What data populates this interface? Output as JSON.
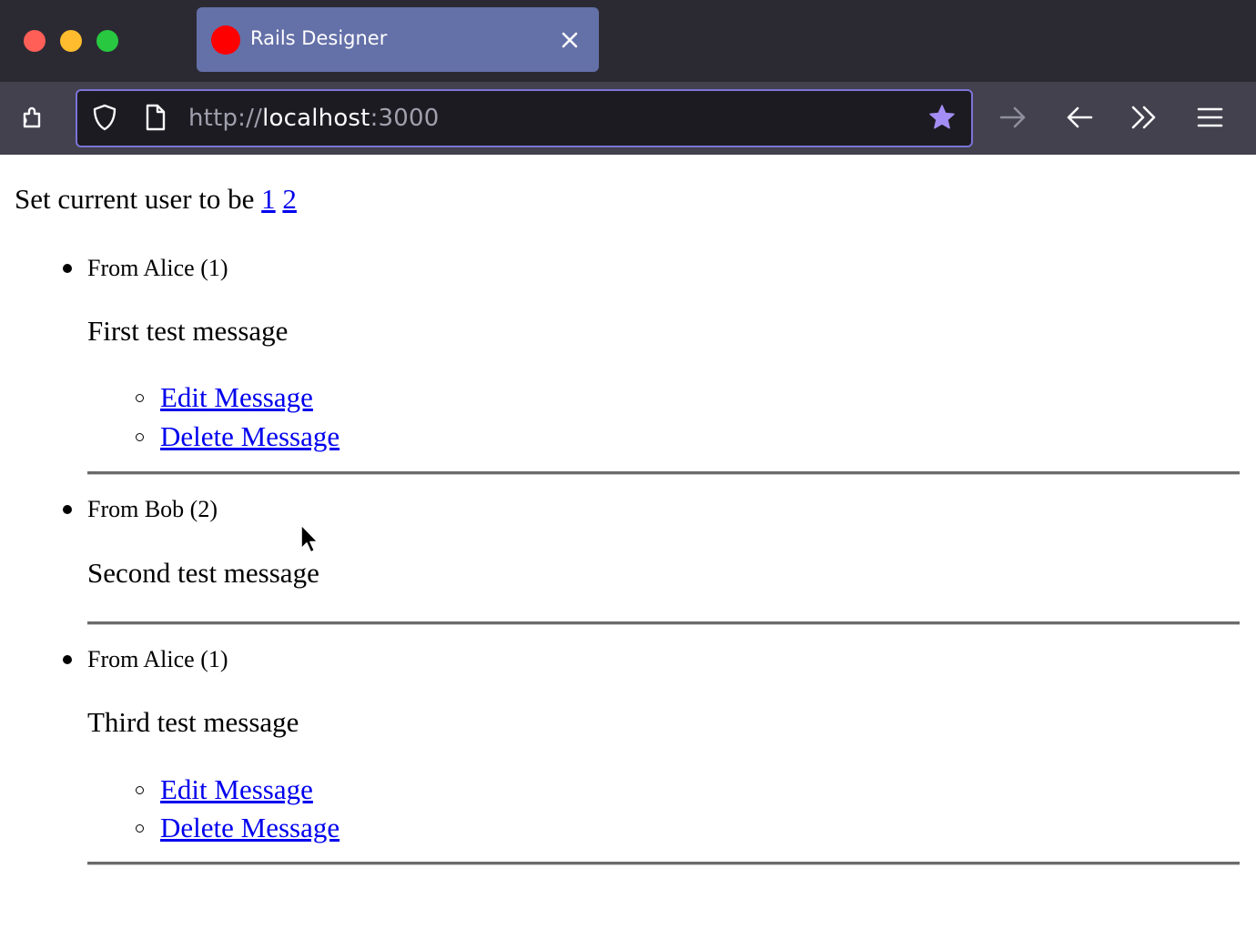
{
  "browser": {
    "tab": {
      "title": "Rails Designer",
      "favicon_color": "#ff0000"
    },
    "url": {
      "scheme": "http://",
      "host": "localhost",
      "port": ":3000"
    },
    "icons": {
      "extensions": "extensions-icon",
      "shield": "shield-icon",
      "page": "page-icon",
      "bookmark": "star-icon",
      "forward": "arrow-right-icon",
      "back": "arrow-left-icon",
      "overflow": "double-chevron-icon",
      "menu": "hamburger-menu-icon"
    },
    "colors": {
      "tab_strip": "#2b2a33",
      "active_tab": "#6470a8",
      "toolbar": "#42414d",
      "url_field": "#1c1b22",
      "focus_ring": "#7c74d8",
      "star": "#a48df5"
    }
  },
  "page": {
    "header": {
      "prefix": "Set current user to be",
      "user_links": [
        "1",
        "2"
      ]
    },
    "messages": [
      {
        "from": "From Alice (1)",
        "body": "First test message",
        "actions": [
          "Edit Message",
          "Delete Message"
        ]
      },
      {
        "from": "From Bob (2)",
        "body": "Second test message",
        "actions": []
      },
      {
        "from": "From Alice (1)",
        "body": "Third test message",
        "actions": [
          "Edit Message",
          "Delete Message"
        ]
      }
    ],
    "link_color": "#0000ee"
  }
}
